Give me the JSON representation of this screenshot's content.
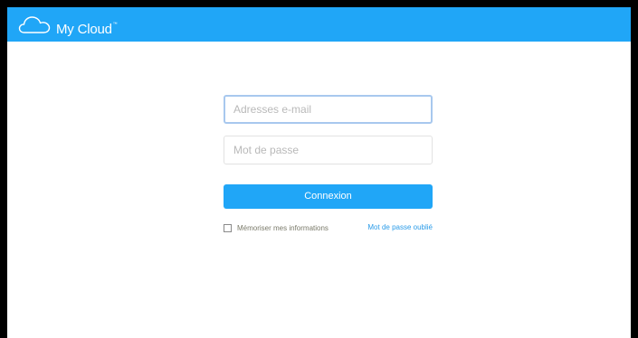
{
  "header": {
    "brand": "My Cloud",
    "brand_mark": "™",
    "logo_icon": "cloud-icon",
    "background_color": "#20a6f7"
  },
  "login_form": {
    "email_placeholder": "Adresses e-mail",
    "password_placeholder": "Mot de passe",
    "submit_label": "Connexion",
    "remember_label": "Mémoriser mes informations",
    "remember_checked": false,
    "forgot_password_label": "Mot de passe oublié"
  },
  "colors": {
    "accent": "#20a6f7",
    "link": "#2a9be8",
    "focus_border": "#a8c8ee"
  }
}
